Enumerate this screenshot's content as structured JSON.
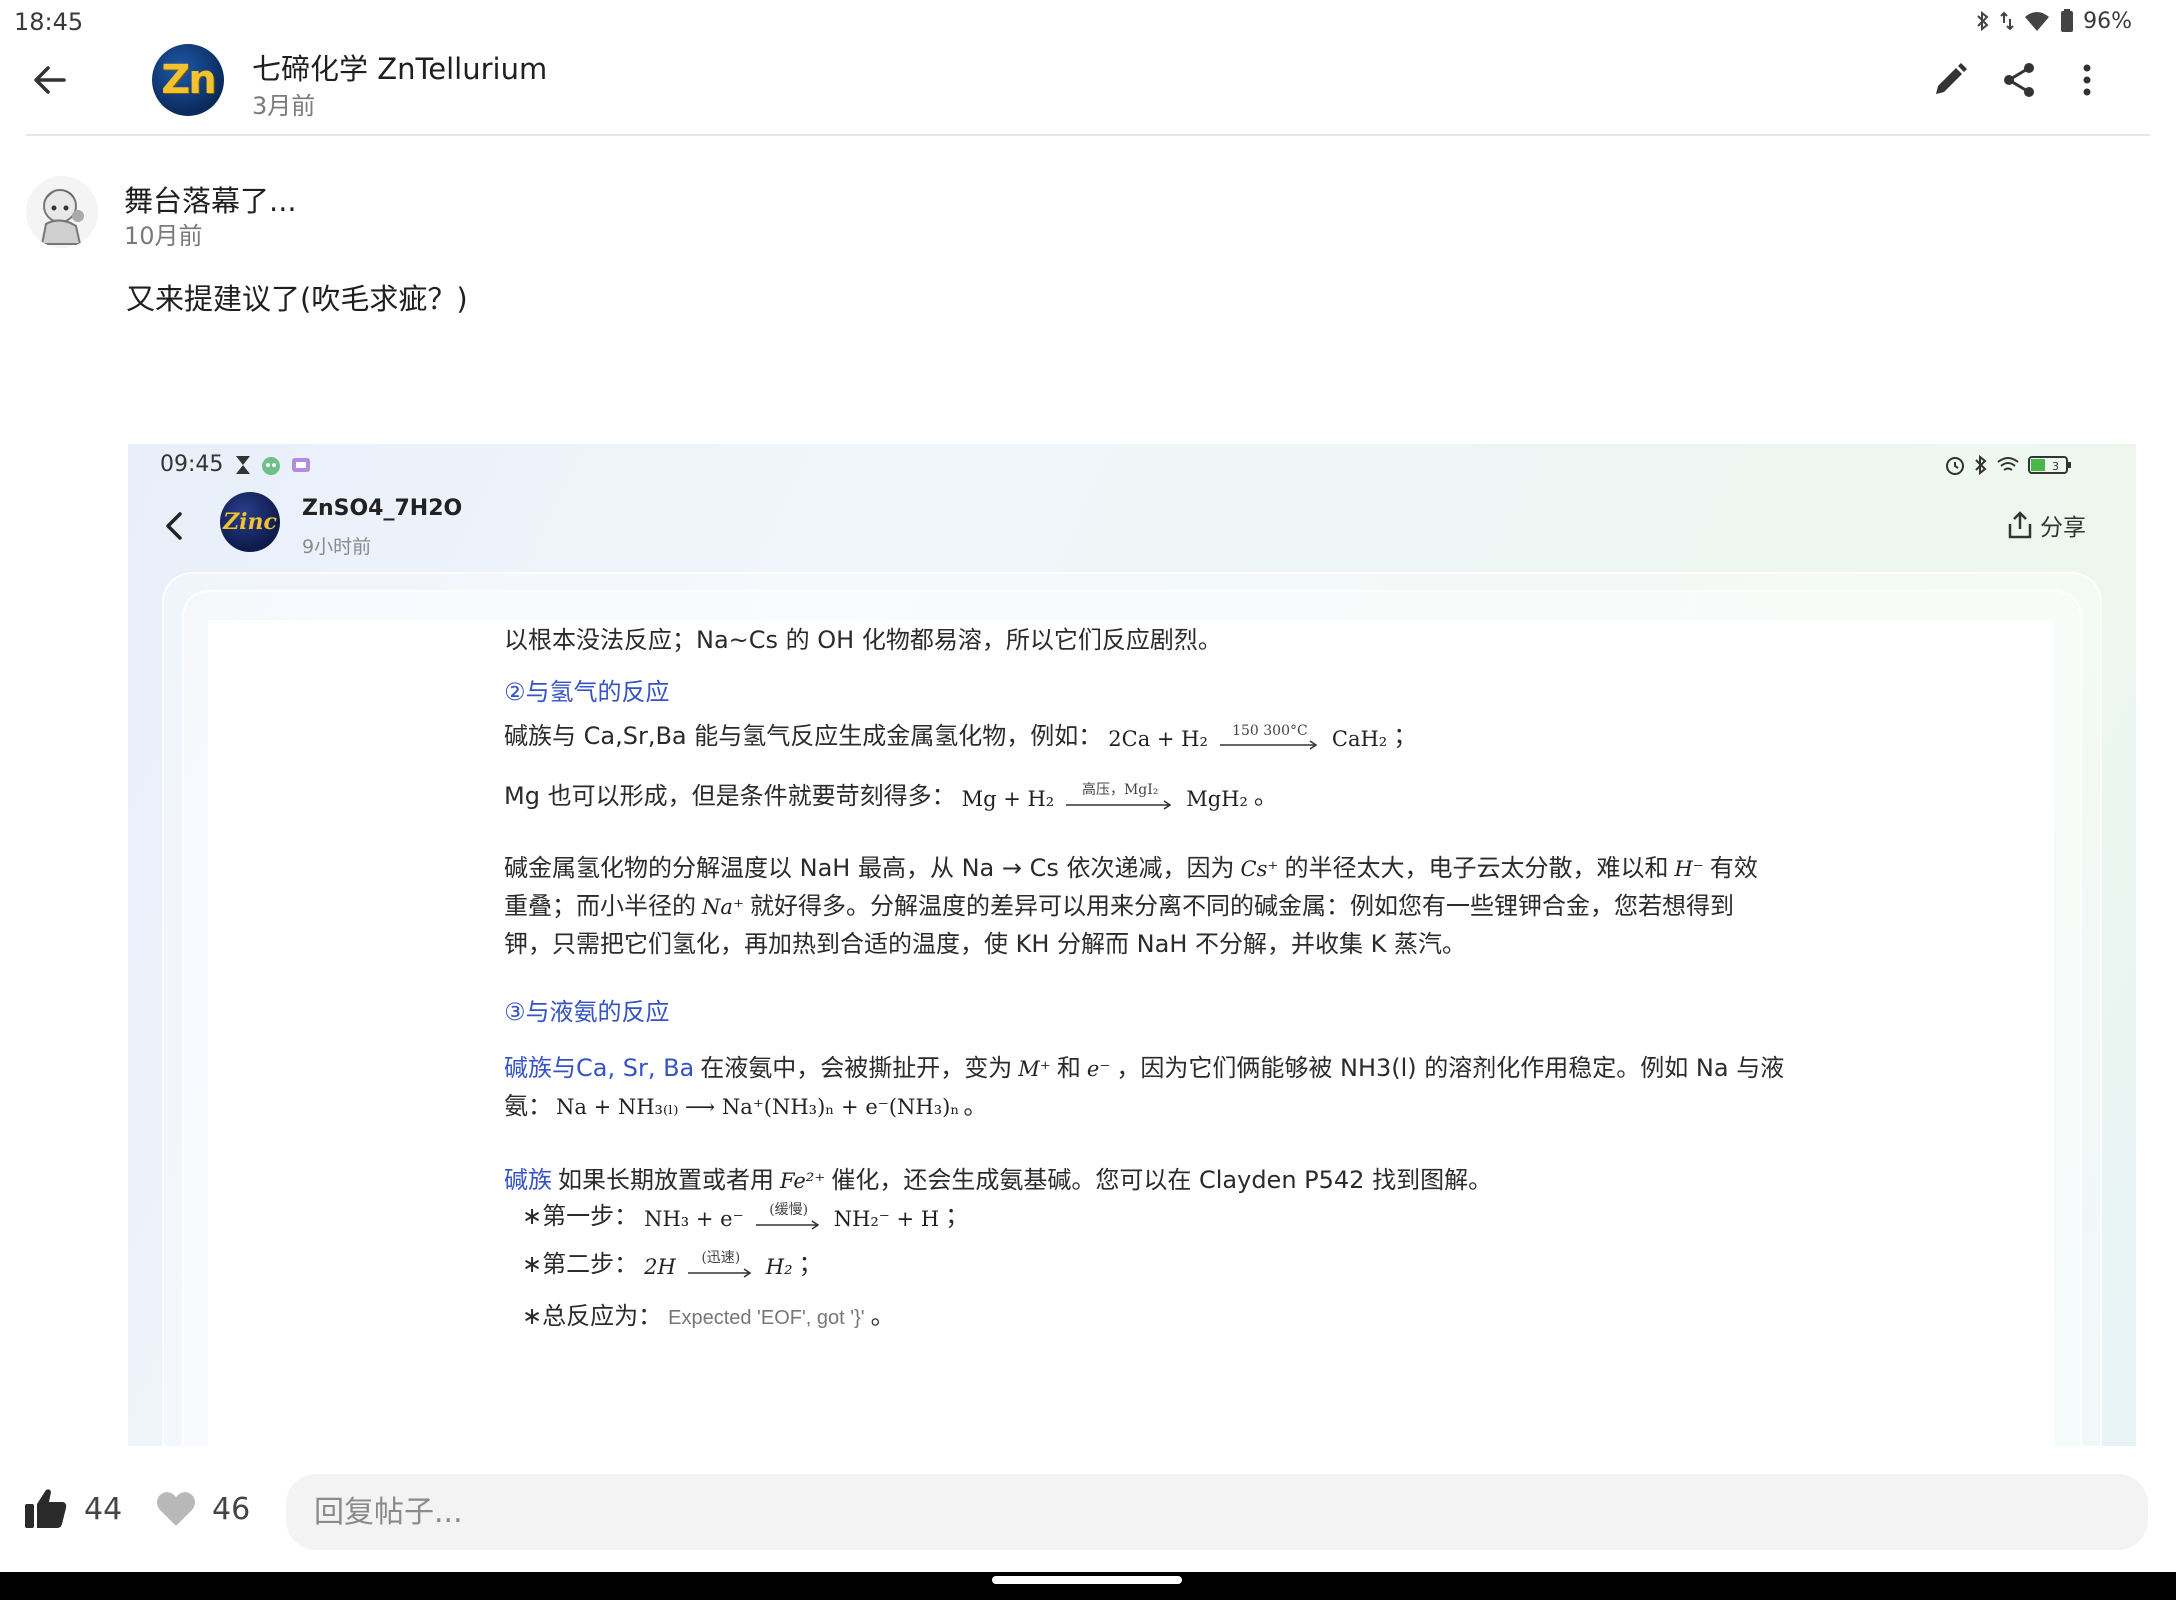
{
  "status_bar": {
    "time": "18:45",
    "battery": "96%"
  },
  "header": {
    "author_name": "七碲化学 ZnTellurium",
    "avatar_text": "Zn",
    "time": "3月前"
  },
  "reply": {
    "name": "舞台落幕了...",
    "time": "10月前",
    "text": "又来提建议了(吹毛求疵？)"
  },
  "embed": {
    "time": "09:45",
    "author_name": "ZnSO4_7H2O",
    "avatar_text": "Zinc",
    "post_time": "9小时前",
    "share_label": "分享",
    "battery_level": "3",
    "doc": {
      "line1": "以根本没法反应；Na~Cs 的 OH 化物都易溶，所以它们反应剧烈。",
      "h2": "②与氢气的反应",
      "p2_text": "碱族与 Ca,Sr,Ba 能与氢气反应生成金属氢化物，例如：",
      "p2_math_left": "2Ca + H₂",
      "p2_math_over": "150 300°C",
      "p2_math_right": "CaH₂",
      "p2_end": "；",
      "p3_text": "Mg 也可以形成，但是条件就要苛刻得多：",
      "p3_math_left": "Mg + H₂",
      "p3_math_over": "高压，MgI₂",
      "p3_math_right": "MgH₂",
      "p3_end": "。",
      "p4_l1_a": "碱金属氢化物的分解温度以 NaH 最高，从 Na → Cs 依次递减，因为",
      "p4_l1_m1": "Cs⁺",
      "p4_l1_b": "的半径太大，电子云太分散，难以和",
      "p4_l1_m2": "H⁻",
      "p4_l1_c": "有效",
      "p4_l2_a": "重叠；而小半径的",
      "p4_l2_m": "Na⁺",
      "p4_l2_b": "就好得多。分解温度的差异可以用来分离不同的碱金属：例如您有一些锂钾合金，您若想得到",
      "p4_l3": "钾，只需把它们氢化，再加热到合适的温度，使 KH 分解而 NaH 不分解，并收集 K 蒸汽。",
      "h3": "③与液氨的反应",
      "p5_link": "碱族与Ca, Sr, Ba",
      "p5_a": "在液氨中，会被撕扯开，变为",
      "p5_m1": "M⁺",
      "p5_and": "和",
      "p5_m2": "e⁻",
      "p5_b": "，因为它们俩能够被 NH3(l) 的溶剂化作用稳定。例如 Na 与液",
      "p5_l2_a": "氨：",
      "p5_l2_m": "Na + NH₃₍ₗ₎ ⟶ Na⁺(NH₃)ₙ + e⁻(NH₃)ₙ",
      "p5_l2_end": "。",
      "p6_link": "碱族",
      "p6_a": "如果长期放置或者用",
      "p6_m": "Fe²⁺",
      "p6_b": "催化，还会生成氨基碱。您可以在 Clayden P542 找到图解。",
      "step1_label": "∗第一步：",
      "step1_left": "NH₃ + e⁻",
      "step1_over": "(缓慢)",
      "step1_right": "NH₂⁻ + H",
      "step1_end": "；",
      "step2_label": "∗第二步：",
      "step2_left": "2H",
      "step2_over": "(迅速)",
      "step2_right": "H₂",
      "step2_end": "；",
      "step3_label": "∗总反应为：",
      "step3_err": "Expected 'EOF', got '}'",
      "step3_end": "。"
    }
  },
  "footer": {
    "like_count": "44",
    "fav_count": "46",
    "reply_placeholder": "回复帖子..."
  },
  "colors": {
    "link": "#3553c4",
    "avatar_gold": "#f2c230",
    "avatar_blue": "#0b2a5c"
  },
  "icons": [
    "back-arrow-icon",
    "edit-pencil-icon",
    "share-icon",
    "more-vert-icon",
    "thumb-up-icon",
    "heart-icon"
  ]
}
